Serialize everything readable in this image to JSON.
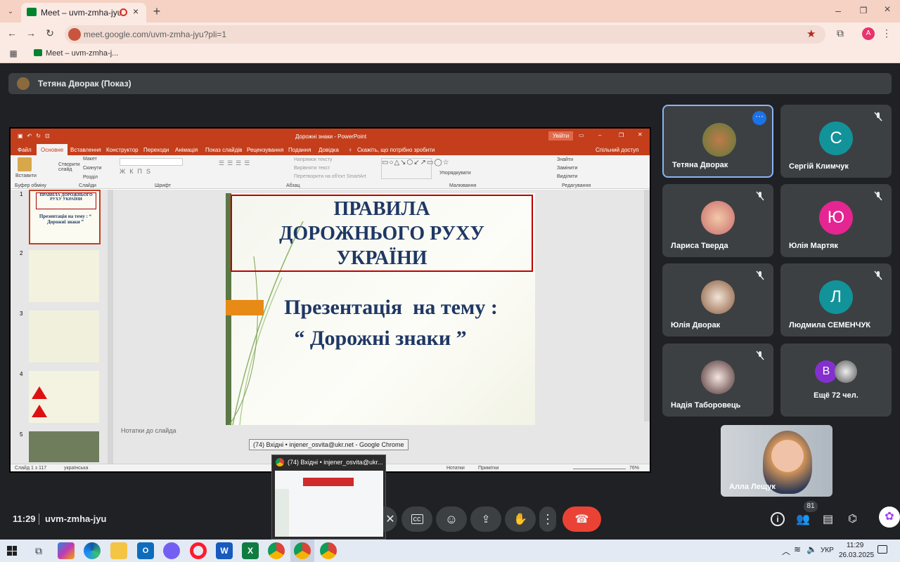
{
  "browser": {
    "tab_title": "Meet – uvm-zmha-jyu",
    "url": "meet.google.com/uvm-zmha-jyu?pli=1",
    "bookmark": "Meet – uvm-zmha-j...",
    "profile_letter": "A"
  },
  "meet": {
    "presenter_label": "Тетяна Дворак (Показ)",
    "time": "11:29",
    "meeting_code": "uvm-zmha-jyu",
    "participants_count": "81",
    "hover_tooltip": "(74) Вхідні • injener_osvita@ukr.net - Google Chrome",
    "preview_title": "(74) Вхідні • injener_osvita@ukr..."
  },
  "powerpoint": {
    "title": "Дорожні знаки - PowerPoint",
    "signin": "Увійти",
    "menu": [
      "Файл",
      "Основне",
      "Вставлення",
      "Конструктор",
      "Переходи",
      "Анімація",
      "Показ слайдів",
      "Рецензування",
      "Подання",
      "Довідка",
      "Скажіть, що потрібно зробити",
      "Спільний доступ"
    ],
    "ribbon": {
      "paste": "Вставити",
      "clipboard": "Буфер обміну",
      "new_slide": "Створити слайд",
      "layout": "Макет",
      "reset": "Скинути",
      "section": "Розділ",
      "slides": "Слайди",
      "font": "Шрифт",
      "paragraph": "Абзац",
      "arrange": "Упорядкувати",
      "drawing": "Малювання",
      "find": "Знайти",
      "replace": "Замінити",
      "select": "Виділити",
      "editing": "Редагування",
      "text_direction": "Напрямок тексту",
      "align_text": "Вирівняти текст",
      "smartart": "Перетворити на об'єкт SmartArt"
    },
    "slide": {
      "title_lines": [
        "ПРАВИЛА",
        "ДОРОЖНЬОГО РУХУ",
        "УКРАЇНИ"
      ],
      "subtitle_1": "Презентація  на тему :",
      "subtitle_2": "“ Дорожні знаки ”"
    },
    "thumb_1_title": "ПРАВИЛА ДОРОЖНЬОГО РУХУ УКРАЇНИ",
    "thumb_1_sub": "Презентація на тему : “ Дорожні знаки ”",
    "thumb_numbers": [
      "1",
      "2",
      "3",
      "4",
      "5"
    ],
    "notes": "Нотатки до слайда",
    "status": {
      "slide": "Слайд 1 з 117",
      "lang": "українська",
      "notes": "Нотатки",
      "comments": "Примітки",
      "zoom": "76%"
    }
  },
  "participants": [
    {
      "name": "Тетяна Дворак",
      "initial": "",
      "color": ""
    },
    {
      "name": "Сергій Климчук",
      "initial": "С",
      "color": "#12939a"
    },
    {
      "name": "Лариса Тверда",
      "initial": "",
      "color": ""
    },
    {
      "name": "Юлія Мартяк",
      "initial": "Ю",
      "color": "#e52592"
    },
    {
      "name": "Юлія Дворак",
      "initial": "",
      "color": ""
    },
    {
      "name": "Людмила СЕМЕНЧУК",
      "initial": "Л",
      "color": "#12939a"
    },
    {
      "name": "Надія Таборовець",
      "initial": "",
      "color": ""
    },
    {
      "name": "Ещё 72 чел.",
      "initial": "B",
      "color": "#8430ce"
    }
  ],
  "self_view_name": "Алла Лещук",
  "taskbar": {
    "lang": "УКР",
    "time": "11:29",
    "date": "26.03.2025"
  }
}
